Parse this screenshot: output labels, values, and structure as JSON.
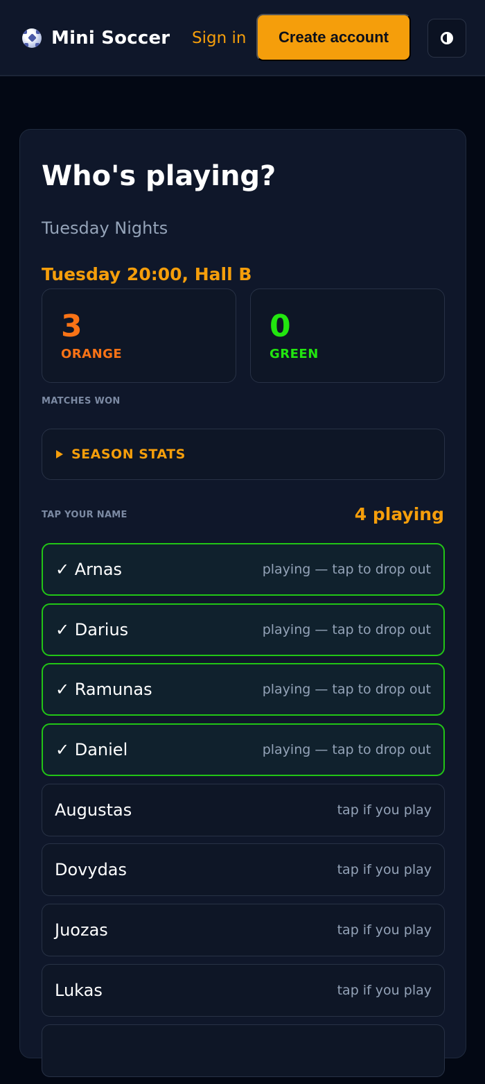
{
  "header": {
    "brand": "Mini Soccer",
    "brand_icon": "soccer-ball-icon",
    "signin_label": "Sign in",
    "create_label": "Create account",
    "theme_icon": "contrast-icon"
  },
  "main": {
    "title": "Who's playing?",
    "group": "Tuesday Nights",
    "when": "Tuesday 20:00, Hall B",
    "scores": [
      {
        "value": "3",
        "label": "ORANGE",
        "color": "#f97316"
      },
      {
        "value": "0",
        "label": "GREEN",
        "color": "#22e60f"
      }
    ],
    "scores_caption": "MATCHES WON",
    "season_label": "SEASON STATS",
    "tap_label": "TAP YOUR NAME",
    "count_label": "4 playing",
    "players": [
      {
        "name": "✓ Arnas",
        "hint": "playing — tap to drop out",
        "playing": true
      },
      {
        "name": "✓ Darius",
        "hint": "playing — tap to drop out",
        "playing": true
      },
      {
        "name": "✓ Ramunas",
        "hint": "playing — tap to drop out",
        "playing": true
      },
      {
        "name": "✓ Daniel",
        "hint": "playing — tap to drop out",
        "playing": true
      },
      {
        "name": "Augustas",
        "hint": "tap if you play",
        "playing": false
      },
      {
        "name": "Dovydas",
        "hint": "tap if you play",
        "playing": false
      },
      {
        "name": "Juozas",
        "hint": "tap if you play",
        "playing": false
      },
      {
        "name": "Lukas",
        "hint": "tap if you play",
        "playing": false
      },
      {
        "name": "",
        "hint": "",
        "playing": false
      }
    ]
  },
  "colors": {
    "accent": "#f59e0b",
    "playing_border": "#22c516",
    "background": "#030814",
    "card": "#0f172a"
  }
}
